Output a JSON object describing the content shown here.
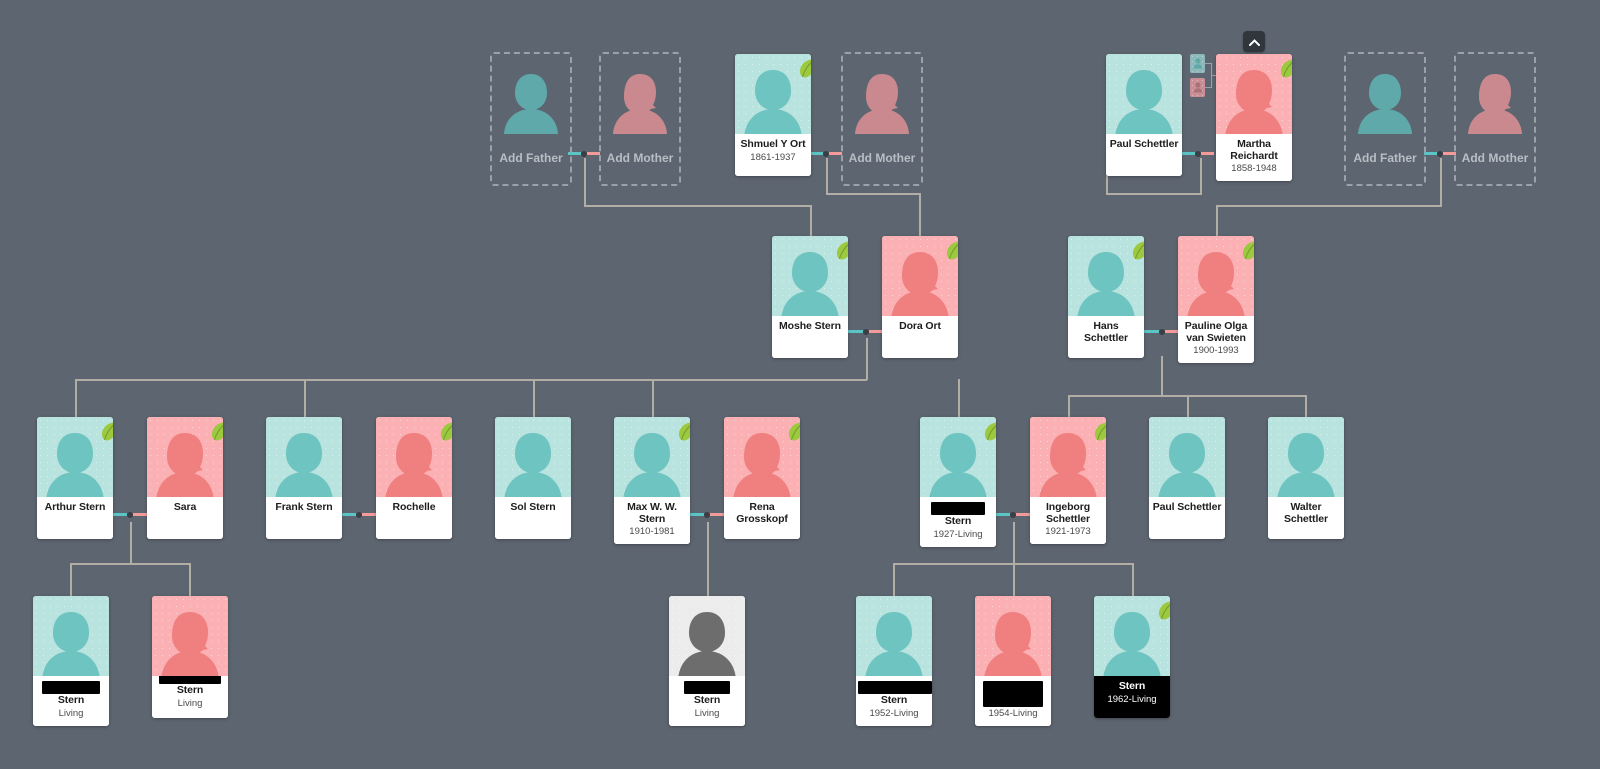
{
  "app": {
    "name": "family-tree-viewer",
    "background_color": "#5d6570",
    "line_color": "#b2aea6",
    "male_color": "#b9e3df",
    "female_color": "#fbb0b4",
    "unknown_color": "#ececec",
    "male_connector_color": "#5bc4c4",
    "female_connector_color": "#f49a9a"
  },
  "controls": {
    "collapse_button": {
      "label": "",
      "icon": "chevron-up-icon",
      "title": "Collapse"
    },
    "parent_indicator": {
      "icon": "parents-indicator-icon",
      "title": "Show parents"
    }
  },
  "placeholders": [
    {
      "id": "add-father-1",
      "label": "Add Father",
      "gender": "m"
    },
    {
      "id": "add-mother-1",
      "label": "Add Mother",
      "gender": "f"
    },
    {
      "id": "add-mother-2",
      "label": "Add Mother",
      "gender": "f"
    },
    {
      "id": "add-father-2",
      "label": "Add Father",
      "gender": "m"
    },
    {
      "id": "add-mother-3",
      "label": "Add Mother",
      "gender": "f"
    }
  ],
  "people": [
    {
      "id": "shmuel-y-ort",
      "name": "Shmuel Y Ort",
      "years": "1861-1937",
      "gender": "m",
      "leaf": true,
      "redacted": false,
      "black": false
    },
    {
      "id": "paul-schettler-sr",
      "name": "Paul Schettler",
      "years": "",
      "gender": "m",
      "leaf": false,
      "redacted": false,
      "black": false
    },
    {
      "id": "martha-reichardt",
      "name": "Martha Reichardt",
      "years": "1858-1948",
      "gender": "f",
      "leaf": true,
      "redacted": false,
      "black": false
    },
    {
      "id": "moshe-stern",
      "name": "Moshe Stern",
      "years": "",
      "gender": "m",
      "leaf": true,
      "redacted": false,
      "black": false
    },
    {
      "id": "dora-ort",
      "name": "Dora Ort",
      "years": "",
      "gender": "f",
      "leaf": true,
      "redacted": false,
      "black": false
    },
    {
      "id": "hans-schettler",
      "name": "Hans Schettler",
      "years": "",
      "gender": "m",
      "leaf": true,
      "redacted": false,
      "black": false
    },
    {
      "id": "pauline-olga-van-swieten",
      "name": "Pauline Olga van Swieten",
      "years": "1900-1993",
      "gender": "f",
      "leaf": true,
      "redacted": false,
      "black": false
    },
    {
      "id": "arthur-stern",
      "name": "Arthur Stern",
      "years": "",
      "gender": "m",
      "leaf": true,
      "redacted": false,
      "black": false
    },
    {
      "id": "sara",
      "name": "Sara",
      "years": "",
      "gender": "f",
      "leaf": true,
      "redacted": false,
      "black": false
    },
    {
      "id": "frank-stern",
      "name": "Frank Stern",
      "years": "",
      "gender": "m",
      "leaf": false,
      "redacted": false,
      "black": false
    },
    {
      "id": "rochelle",
      "name": "Rochelle",
      "years": "",
      "gender": "f",
      "leaf": true,
      "redacted": false,
      "black": false
    },
    {
      "id": "sol-stern",
      "name": "Sol Stern",
      "years": "",
      "gender": "m",
      "leaf": false,
      "redacted": false,
      "black": false
    },
    {
      "id": "max-w-w-stern",
      "name": "Max W. W. Stern",
      "years": "1910-1981",
      "gender": "m",
      "leaf": true,
      "redacted": false,
      "black": false
    },
    {
      "id": "rena-grosskopf",
      "name": "Rena Grosskopf",
      "years": "",
      "gender": "f",
      "leaf": true,
      "redacted": false,
      "black": false
    },
    {
      "id": "redacted-stern-1927",
      "name": "Stern",
      "years": "1927-Living",
      "gender": "m",
      "leaf": true,
      "redacted": true,
      "black": false
    },
    {
      "id": "ingeborg-schettler",
      "name": "Ingeborg Schettler",
      "years": "1921-1973",
      "gender": "f",
      "leaf": true,
      "redacted": false,
      "black": false
    },
    {
      "id": "paul-schettler-jr",
      "name": "Paul Schettler",
      "years": "",
      "gender": "m",
      "leaf": false,
      "redacted": false,
      "black": false
    },
    {
      "id": "walter-schettler",
      "name": "Walter Schettler",
      "years": "",
      "gender": "m",
      "leaf": false,
      "redacted": false,
      "black": false
    },
    {
      "id": "redacted-stern-l1",
      "name": "Stern",
      "years": "Living",
      "gender": "m",
      "leaf": false,
      "redacted": true,
      "black": false
    },
    {
      "id": "redacted-stern-l2",
      "name": "Stern",
      "years": "Living",
      "gender": "f",
      "leaf": false,
      "redacted": true,
      "black": false
    },
    {
      "id": "redacted-stern-l3",
      "name": "Stern",
      "years": "Living",
      "gender": "u",
      "leaf": false,
      "redacted": true,
      "black": false
    },
    {
      "id": "redacted-stern-1952",
      "name": "Stern",
      "years": "1952-Living",
      "gender": "m",
      "leaf": false,
      "redacted": true,
      "black": false
    },
    {
      "id": "redacted-stern-1954",
      "name": "",
      "years": "1954-Living",
      "gender": "f",
      "leaf": false,
      "redacted": true,
      "black": false
    },
    {
      "id": "redacted-stern-1962",
      "name": "Stern",
      "years": "1962-Living",
      "gender": "m",
      "leaf": true,
      "redacted": false,
      "black": true
    }
  ]
}
